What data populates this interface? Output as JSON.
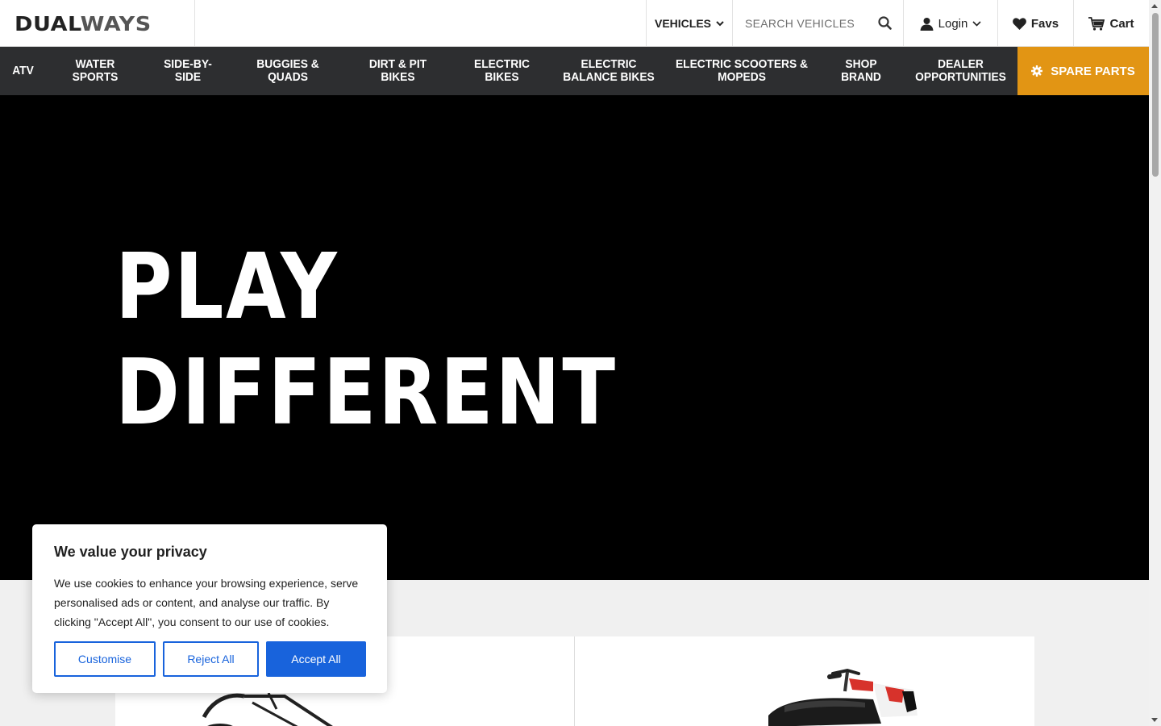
{
  "header": {
    "logo_dark": "DUAL",
    "logo_light": "WAYS",
    "vehicles_label": "VEHICLES",
    "search_placeholder": "SEARCH VEHICLES",
    "login_label": "Login",
    "favs_label": "Favs",
    "cart_label": "Cart"
  },
  "nav": {
    "items": [
      {
        "line1": "ATV",
        "line2": ""
      },
      {
        "line1": "WATER",
        "line2": "SPORTS"
      },
      {
        "line1": "SIDE-BY-",
        "line2": "SIDE"
      },
      {
        "line1": "BUGGIES &",
        "line2": "QUADS"
      },
      {
        "line1": "DIRT & PIT",
        "line2": "BIKES"
      },
      {
        "line1": "ELECTRIC",
        "line2": "BIKES"
      },
      {
        "line1": "ELECTRIC",
        "line2": "BALANCE BIKES"
      },
      {
        "line1": "ELECTRIC SCOOTERS &",
        "line2": "MOPEDS"
      },
      {
        "line1": "SHOP",
        "line2": "BRAND"
      },
      {
        "line1": "DEALER",
        "line2": "OPPORTUNITIES"
      }
    ],
    "spare_parts_label": "SPARE PARTS",
    "spare_parts_color": "#e29514"
  },
  "hero": {
    "line1": "PLAY",
    "line2": "DIFFERENT"
  },
  "cookie": {
    "title": "We value your privacy",
    "text": "We use cookies to enhance your browsing experience, serve personalised ads or content, and analyse our traffic. By clicking \"Accept All\", you consent to our use of cookies.",
    "customise": "Customise",
    "reject": "Reject All",
    "accept": "Accept All",
    "accent_color": "#1863dc"
  }
}
